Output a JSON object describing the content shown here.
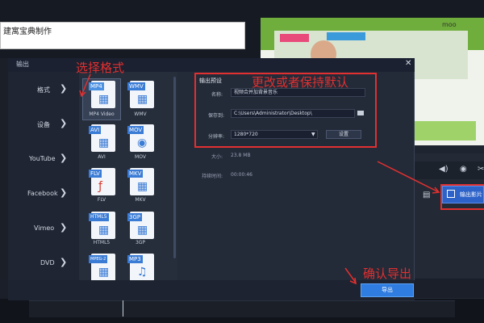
{
  "background": {
    "title_text": "建寓宝典制作",
    "preview_watermark": "moo",
    "timeline_icons": [
      "speaker-icon",
      "camera-icon",
      "scissor-icon",
      "list-icon"
    ],
    "export_video_label": "输出影片"
  },
  "dialog": {
    "title": "输出",
    "close_glyph": "✕",
    "sidebar": [
      {
        "label": "格式"
      },
      {
        "label": "设备"
      },
      {
        "label": "YouTube"
      },
      {
        "label": "Facebook"
      },
      {
        "label": "Vimeo"
      },
      {
        "label": "DVD"
      }
    ],
    "formats": [
      {
        "tag": "MP4",
        "name": "MP4 Video",
        "color": "#4a90e2"
      },
      {
        "tag": "WMV",
        "name": "WMV",
        "color": "#3a7bd5"
      },
      {
        "tag": "AVI",
        "name": "AVI",
        "color": "#3a7bd5"
      },
      {
        "tag": "MOV",
        "name": "MOV",
        "color": "#3a7bd5"
      },
      {
        "tag": "FLV",
        "name": "FLV",
        "color": "#3a7bd5"
      },
      {
        "tag": "MKV",
        "name": "MKV",
        "color": "#3a7bd5"
      },
      {
        "tag": "HTML5",
        "name": "HTML5",
        "color": "#3a7bd5"
      },
      {
        "tag": "3GP",
        "name": "3GP",
        "color": "#3a7bd5"
      },
      {
        "tag": "MPEG-2",
        "name": "",
        "color": "#3a7bd5"
      },
      {
        "tag": "MP3",
        "name": "",
        "color": "#3a7bd5"
      }
    ],
    "settings": {
      "section_title": "输出预设",
      "name_label": "名称:",
      "name_value": "视频合并加背景音乐",
      "save_label": "保存到:",
      "save_value": "C:\\Users\\Administrator\\Desktop\\",
      "resolution_label": "分辨率:",
      "resolution_value": "1280*720",
      "settings_button": "设置",
      "size_label": "大小:",
      "size_value": "23.8 MB",
      "duration_label": "持续时间:",
      "duration_value": "00:00:46"
    },
    "export_button": "导出"
  },
  "annotations": {
    "select_format": "选择格式",
    "change_or_keep": "更改或者保持默认",
    "confirm_export": "确认导出",
    "color": "#e23030"
  }
}
